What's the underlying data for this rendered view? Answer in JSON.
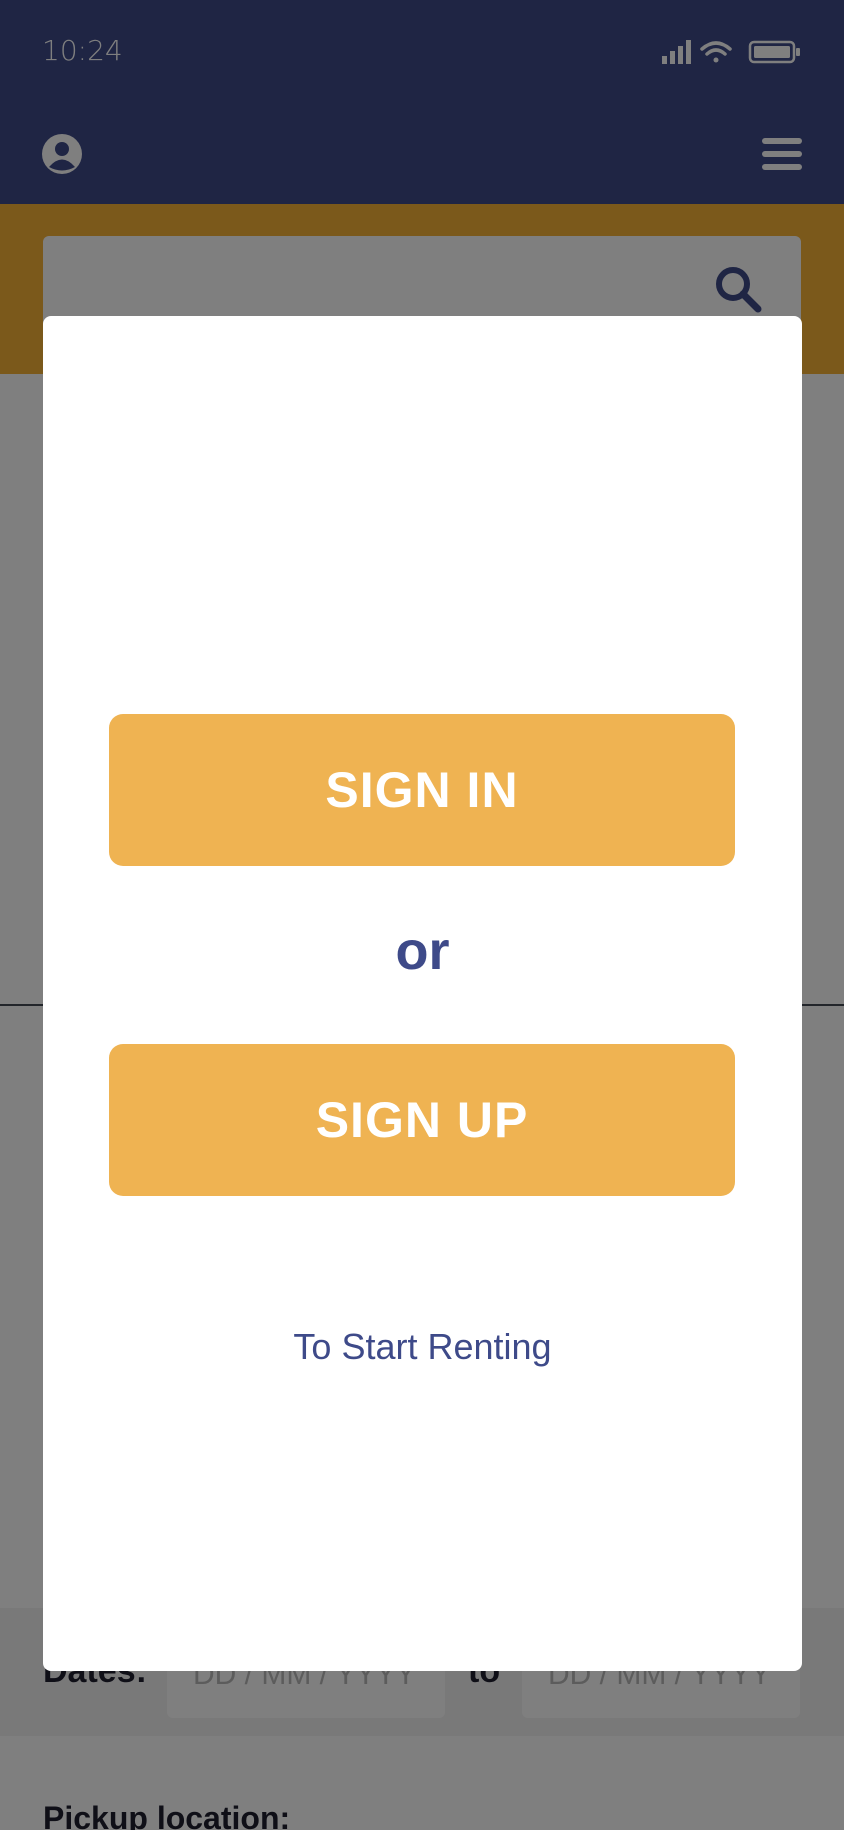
{
  "status_bar": {
    "time": "10:24",
    "icons": [
      "signal-icon",
      "wifi-icon",
      "battery-icon"
    ]
  },
  "header": {
    "icons": [
      "avatar-icon",
      "menu-icon"
    ]
  },
  "search": {
    "icon": "search-icon"
  },
  "filters": {
    "dates_label": "Dates:",
    "start_placeholder": "DD / MM / YYYY",
    "to_label": "to",
    "end_placeholder": "DD / MM / YYYY",
    "pickup_label": "Pickup location:"
  },
  "modal": {
    "signin_label": "SIGN IN",
    "or_text": "or",
    "signup_label": "SIGN UP",
    "tagline": "To Start Renting"
  },
  "colors": {
    "brand_navy": "#3e4a89",
    "accent_orange": "#f7b236",
    "button_orange": "#efb352",
    "overlay": "rgba(0,0,0,0.5)"
  }
}
